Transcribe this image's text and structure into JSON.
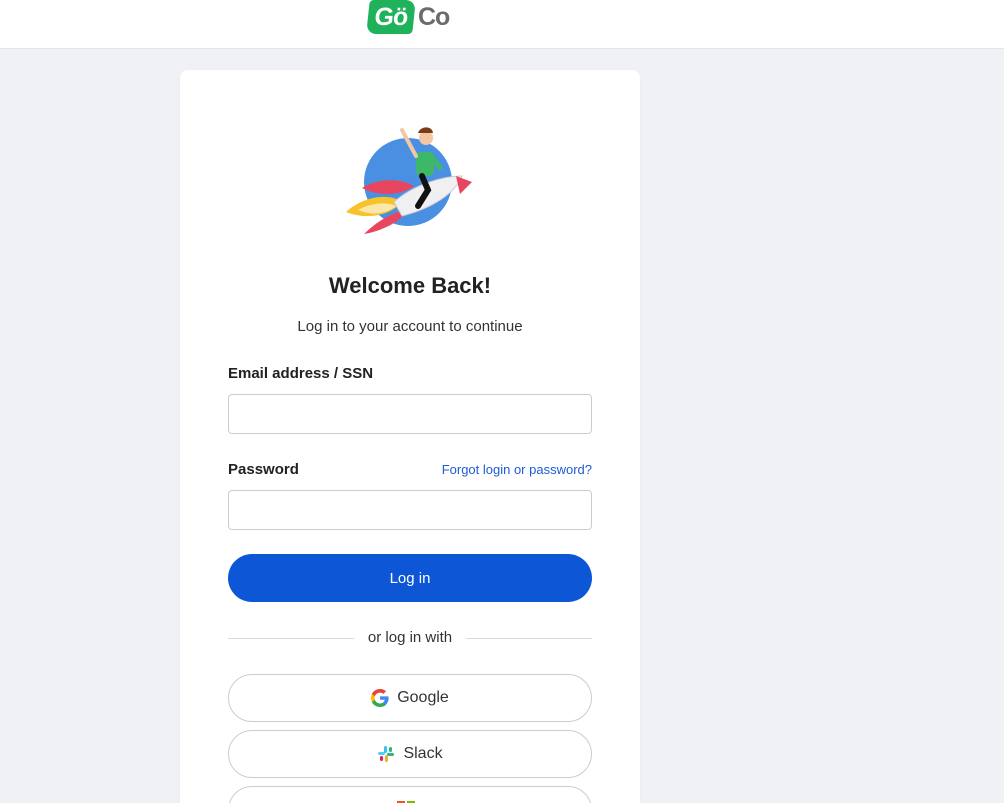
{
  "brand": {
    "logo_left": "Gö",
    "logo_right": "Co"
  },
  "login": {
    "title": "Welcome Back!",
    "subtitle": "Log in to your account to continue",
    "email_label": "Email address / SSN",
    "email_value": "",
    "password_label": "Password",
    "password_value": "",
    "forgot_link": "Forgot login or password?",
    "submit_label": "Log in",
    "divider_text": "or log in with"
  },
  "sso": [
    {
      "label": "Google",
      "icon": "google-icon"
    },
    {
      "label": "Slack",
      "icon": "slack-icon"
    },
    {
      "label": "",
      "icon": "microsoft-icon"
    }
  ],
  "colors": {
    "brand_green": "#1fb25a",
    "primary": "#0d57d7",
    "link": "#1e5bd6",
    "background": "#eff1f5"
  }
}
